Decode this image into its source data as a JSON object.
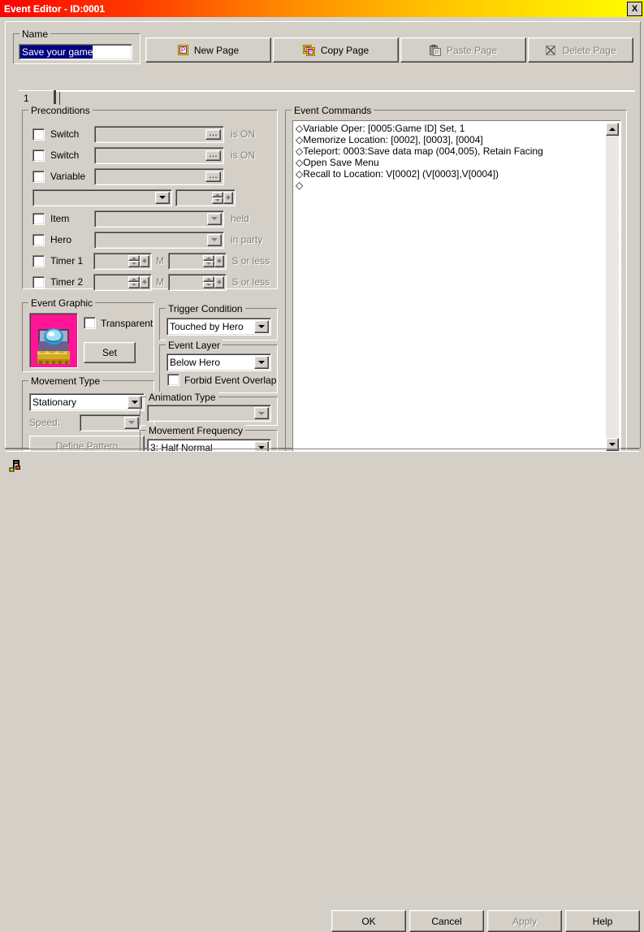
{
  "window": {
    "title": "Event Editor - ID:0001",
    "close_label": "X",
    "titlebar_gradient_from": "#ff0000",
    "titlebar_gradient_to": "#ffff00",
    "face_color": "#d4d0c8"
  },
  "name_group": {
    "legend": "Name",
    "value": "Save your game",
    "selected": true
  },
  "page_buttons": [
    {
      "label": "New Page",
      "icon": "page-icon",
      "enabled": true
    },
    {
      "label": "Copy Page",
      "icon": "copy-page-icon",
      "enabled": true
    },
    {
      "label": "Paste Page",
      "icon": "paste-page-icon",
      "enabled": false
    },
    {
      "label": "Delete Page",
      "icon": "delete-page-icon",
      "enabled": false
    }
  ],
  "tabs": [
    {
      "label": "1",
      "active": true
    }
  ],
  "preconditions": {
    "legend": "Preconditions",
    "rows": [
      {
        "name": "switch1",
        "label": "Switch",
        "checked": false,
        "value": "",
        "suffix": "is ON",
        "control": "browse"
      },
      {
        "name": "switch2",
        "label": "Switch",
        "checked": false,
        "value": "",
        "suffix": "is ON",
        "control": "browse"
      },
      {
        "name": "variable",
        "label": "Variable",
        "checked": false,
        "value": "",
        "suffix": "",
        "control": "browse"
      },
      {
        "name": "item",
        "label": "Item",
        "checked": false,
        "value": "",
        "suffix": "held",
        "control": "combo"
      },
      {
        "name": "hero",
        "label": "Hero",
        "checked": false,
        "value": "",
        "suffix": "in party",
        "control": "combo"
      }
    ],
    "variable_op": {
      "comparison": "",
      "amount": ""
    },
    "timers": [
      {
        "label": "Timer 1",
        "checked": false,
        "minutes": "",
        "min_unit": "M",
        "seconds": "",
        "sec_suffix": "S or less"
      },
      {
        "label": "Timer 2",
        "checked": false,
        "minutes": "",
        "min_unit": "M",
        "seconds": "",
        "sec_suffix": "S or less"
      }
    ]
  },
  "event_graphic": {
    "legend": "Event Graphic",
    "transparent_label": "Transparent",
    "transparent_checked": false,
    "set_label": "Set",
    "sprite": "treasure-chest-sprite",
    "background_color": "#ff1493"
  },
  "movement_type": {
    "legend": "Movement Type",
    "value": "Stationary",
    "speed_label": "Speed:",
    "speed_value": "",
    "speed_enabled": false,
    "define_pattern_label": "Define Pattern",
    "define_pattern_enabled": false
  },
  "trigger_condition": {
    "legend": "Trigger Condition",
    "value": "Touched by Hero"
  },
  "event_layer": {
    "legend": "Event Layer",
    "value": "Below Hero",
    "forbid_overlap_label": "Forbid Event Overlap",
    "forbid_overlap_checked": false
  },
  "animation_type": {
    "legend": "Animation Type",
    "value": "",
    "enabled": false
  },
  "movement_frequency": {
    "legend": "Movement Frequency",
    "value": "3: Half Normal"
  },
  "event_commands": {
    "legend": "Event Commands",
    "lines": [
      "◇Variable Oper: [0005:Game ID] Set, 1",
      "◇Memorize Location: [0002], [0003], [0004]",
      "◇Teleport: 0003:Save data map (004,005), Retain Facing",
      "◇Open Save Menu",
      "◇Recall to Location: V[0002] (V[0003],V[0004])",
      "◇"
    ]
  },
  "bottom_bar": {
    "music_icon": "music-note-icon",
    "buttons": [
      {
        "label": "OK",
        "enabled": true
      },
      {
        "label": "Cancel",
        "enabled": true
      },
      {
        "label": "Apply",
        "enabled": false
      },
      {
        "label": "Help",
        "enabled": true
      }
    ]
  }
}
